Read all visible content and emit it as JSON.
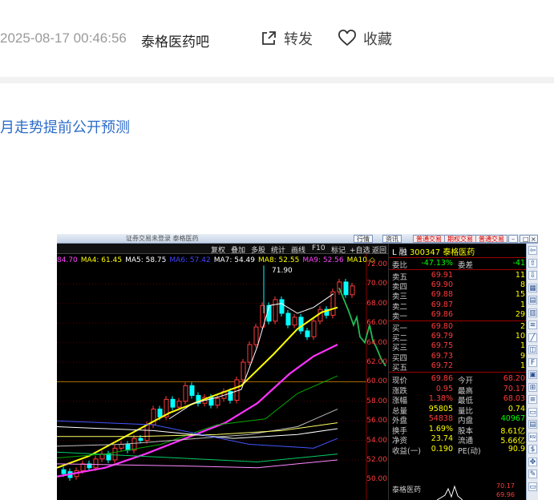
{
  "post": {
    "datetime": "2025-08-17 00:46:56",
    "bar_name": "泰格医药吧",
    "share_label": "转发",
    "favorite_label": "收藏",
    "title": "月走势提前公开预测"
  },
  "stock_window": {
    "title": "证券交易未登录  泰格医药",
    "title_buttons": [
      "行情",
      "资讯",
      "普通交易",
      "期权交易",
      "普通交易"
    ],
    "toolbar": [
      "复权",
      "叠加",
      "多股",
      "统计",
      "画线",
      "F10",
      "标记",
      "+自选",
      "返回"
    ],
    "ma_values": [
      {
        "text": "84.70",
        "color": "#ff44ff"
      },
      {
        "text": "MA4: 61.45",
        "color": "#ffff00"
      },
      {
        "text": "MA5: 58.75",
        "color": "#ffffff"
      },
      {
        "text": "MA6: 57.42",
        "color": "#4444ff"
      },
      {
        "text": "MA7: 54.49",
        "color": "#ffffff"
      },
      {
        "text": "MA8: 52.55",
        "color": "#ffff00"
      },
      {
        "text": "MA9: 52.56",
        "color": "#ff44ff"
      },
      {
        "text": "MA10 ◇",
        "color": "#ffff00"
      }
    ],
    "high_label": "71.90",
    "y_axis": [
      "72.00",
      "70.00",
      "68.00",
      "66.00",
      "64.00",
      "62.00",
      "60.00",
      "58.00",
      "56.00",
      "54.00",
      "52.00",
      "50.00"
    ],
    "stock_code": "300347",
    "stock_name": "泰格医药",
    "stock_prefix": "L 融",
    "weibi": {
      "label": "委比",
      "value": "-47.13%",
      "label2": "委差",
      "value2": "-41"
    },
    "asks": [
      {
        "label": "卖五",
        "price": "69.91",
        "vol": "11"
      },
      {
        "label": "卖四",
        "price": "69.90",
        "vol": "8"
      },
      {
        "label": "卖三",
        "price": "69.88",
        "vol": "15"
      },
      {
        "label": "卖二",
        "price": "69.87",
        "vol": "1"
      },
      {
        "label": "卖一",
        "price": "69.86",
        "vol": "29"
      }
    ],
    "bids": [
      {
        "label": "买一",
        "price": "69.80",
        "vol": "2"
      },
      {
        "label": "买二",
        "price": "69.79",
        "vol": "10"
      },
      {
        "label": "买三",
        "price": "69.75",
        "vol": "1"
      },
      {
        "label": "买四",
        "price": "69.73",
        "vol": "9"
      },
      {
        "label": "买五",
        "price": "69.72",
        "vol": "1"
      }
    ],
    "stats": [
      {
        "l1": "现价",
        "v1": "69.86",
        "c1": "#ff3b3b",
        "l2": "今开",
        "v2": "68.20",
        "c2": "#ff3b3b"
      },
      {
        "l1": "涨跌",
        "v1": "0.95",
        "c1": "#ff3b3b",
        "l2": "最高",
        "v2": "70.17",
        "c2": "#ff3b3b"
      },
      {
        "l1": "涨幅",
        "v1": "1.38%",
        "c1": "#ff3b3b",
        "l2": "最低",
        "v2": "68.03",
        "c2": "#ff3b3b"
      },
      {
        "l1": "总量",
        "v1": "95805",
        "c1": "#ffff00",
        "l2": "量比",
        "v2": "0.74",
        "c2": "#ffff00"
      },
      {
        "l1": "外盘",
        "v1": "54838",
        "c1": "#ff3b3b",
        "l2": "内盘",
        "v2": "40967",
        "c2": "#00ff00"
      },
      {
        "l1": "换手",
        "v1": "1.69%",
        "c1": "#ffff00",
        "l2": "股本",
        "v2": "8.61亿",
        "c2": "#ffff00"
      },
      {
        "l1": "净资",
        "v1": "23.74",
        "c1": "#ffff00",
        "l2": "流通",
        "v2": "5.66亿",
        "c2": "#ffff00"
      },
      {
        "l1": "收益(一)",
        "v1": "0.190",
        "c1": "#ffff00",
        "l2": "PE(动)",
        "v2": "90.9",
        "c2": "#ffff00"
      }
    ],
    "mini_title": "泰格医药",
    "mini_values": [
      "70.17",
      "69.96"
    ],
    "right_tools": [
      "⇦",
      "⇧",
      "⇩",
      "▦",
      "▤",
      "▥",
      "≋",
      "╱",
      "◫",
      "F",
      "▣",
      "⊞",
      "≡",
      "▭",
      "▤",
      "RSI",
      "$",
      "✥",
      "✎",
      "▭"
    ]
  },
  "colors": {
    "link": "#2d6cc9",
    "meta": "#9a9a9a",
    "chart_bg": "#000000",
    "up": "#ff3b3b",
    "down": "#00ffff"
  }
}
